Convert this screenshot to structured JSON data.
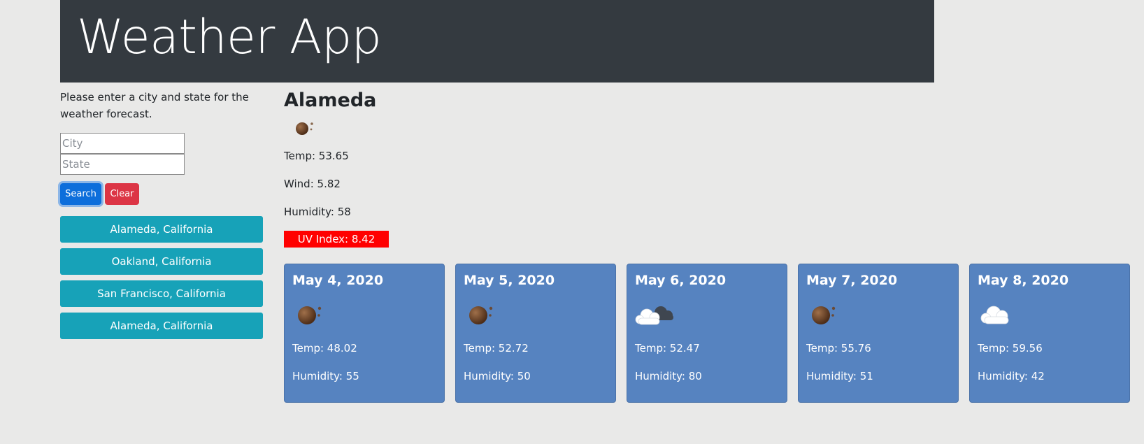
{
  "header": {
    "title": "Weather App"
  },
  "sidebar": {
    "instructions": "Please enter a city and state for the weather forecast.",
    "city_placeholder": "City",
    "state_placeholder": "State",
    "search_label": "Search",
    "clear_label": "Clear",
    "history": [
      "Alameda, California",
      "Oakland, California",
      "San Francisco, California",
      "Alameda, California"
    ]
  },
  "current": {
    "city": "Alameda",
    "icon": "clear-sky-moon-icon",
    "temp": "Temp: 53.65",
    "wind": "Wind: 5.82",
    "humidity": "Humidity: 58",
    "uv": "UV Index: 8.42",
    "uv_color": "#ff0000"
  },
  "forecast": [
    {
      "date": "May 4, 2020",
      "icon": "clear-sky-moon-icon",
      "temp": "Temp: 48.02",
      "humidity": "Humidity: 55"
    },
    {
      "date": "May 5, 2020",
      "icon": "clear-sky-moon-icon",
      "temp": "Temp: 52.72",
      "humidity": "Humidity: 50"
    },
    {
      "date": "May 6, 2020",
      "icon": "broken-clouds-icon",
      "temp": "Temp: 52.47",
      "humidity": "Humidity: 80"
    },
    {
      "date": "May 7, 2020",
      "icon": "clear-sky-moon-icon",
      "temp": "Temp: 55.76",
      "humidity": "Humidity: 51"
    },
    {
      "date": "May 8, 2020",
      "icon": "cloud-icon",
      "temp": "Temp: 59.56",
      "humidity": "Humidity: 42"
    }
  ],
  "colors": {
    "header_bg": "#343a40",
    "search_button": "#0d6edb",
    "clear_button": "#dc3545",
    "history_button": "#17a2b8",
    "forecast_card": "#5683c0"
  }
}
